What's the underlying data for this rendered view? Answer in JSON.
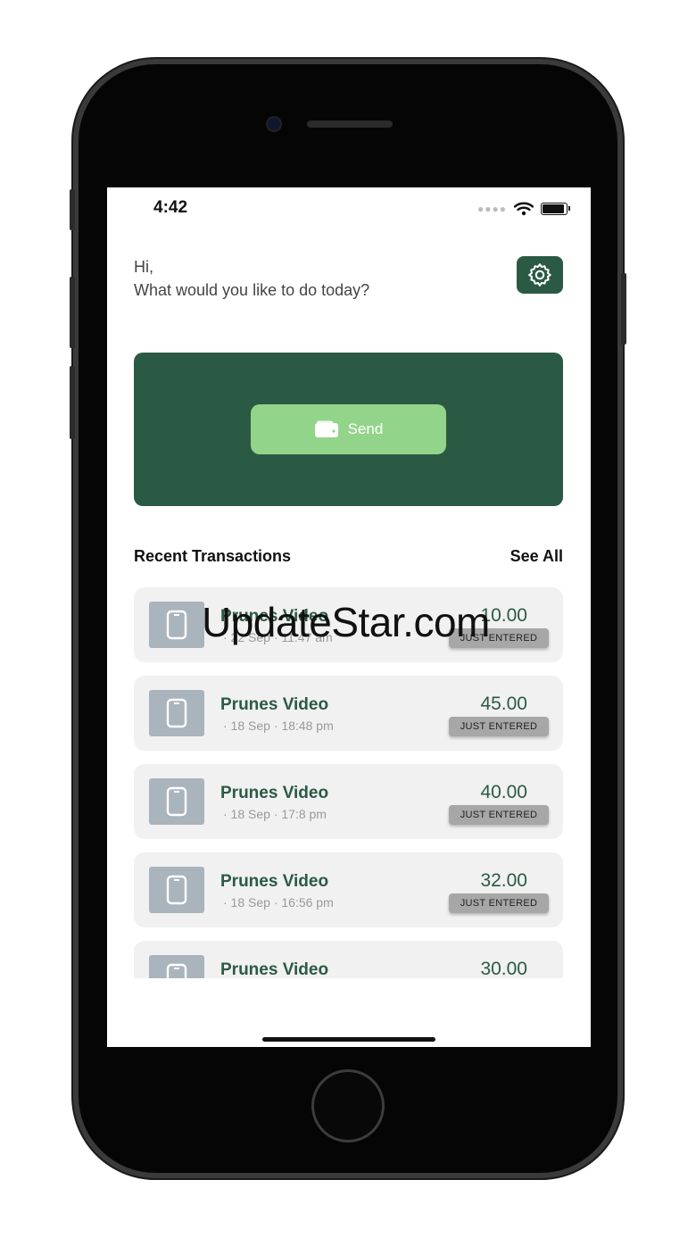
{
  "status_bar": {
    "time": "4:42"
  },
  "greeting": {
    "line1": "Hi,",
    "line2": "What would you like to do today?"
  },
  "send_button": {
    "label": "Send"
  },
  "recent": {
    "title": "Recent Transactions",
    "see_all": "See All"
  },
  "transactions": [
    {
      "title": "Prunes Video",
      "date": "· 22 Sep",
      "time": "· 11:47 am",
      "amount": "10.00",
      "status": "JUST ENTERED"
    },
    {
      "title": "Prunes Video",
      "date": "· 18 Sep",
      "time": "· 18:48 pm",
      "amount": "45.00",
      "status": "JUST ENTERED"
    },
    {
      "title": "Prunes Video",
      "date": "· 18 Sep",
      "time": "· 17:8 pm",
      "amount": "40.00",
      "status": "JUST ENTERED"
    },
    {
      "title": "Prunes Video",
      "date": "· 18 Sep",
      "time": "· 16:56 pm",
      "amount": "32.00",
      "status": "JUST ENTERED"
    },
    {
      "title": "Prunes Video",
      "date": "",
      "time": "",
      "amount": "30.00",
      "status": ""
    }
  ],
  "watermark": "UpdateStar.com",
  "icons": {
    "settings": "gear-icon",
    "send": "wallet-icon",
    "transaction": "phone-icon",
    "wifi": "wifi-icon",
    "battery": "battery-icon"
  },
  "colors": {
    "primary": "#2b5a44",
    "send_button": "#92d58a",
    "card_bg": "#f1f1f1",
    "icon_bg": "#aab4bd",
    "badge_bg": "#a7a7a7"
  }
}
